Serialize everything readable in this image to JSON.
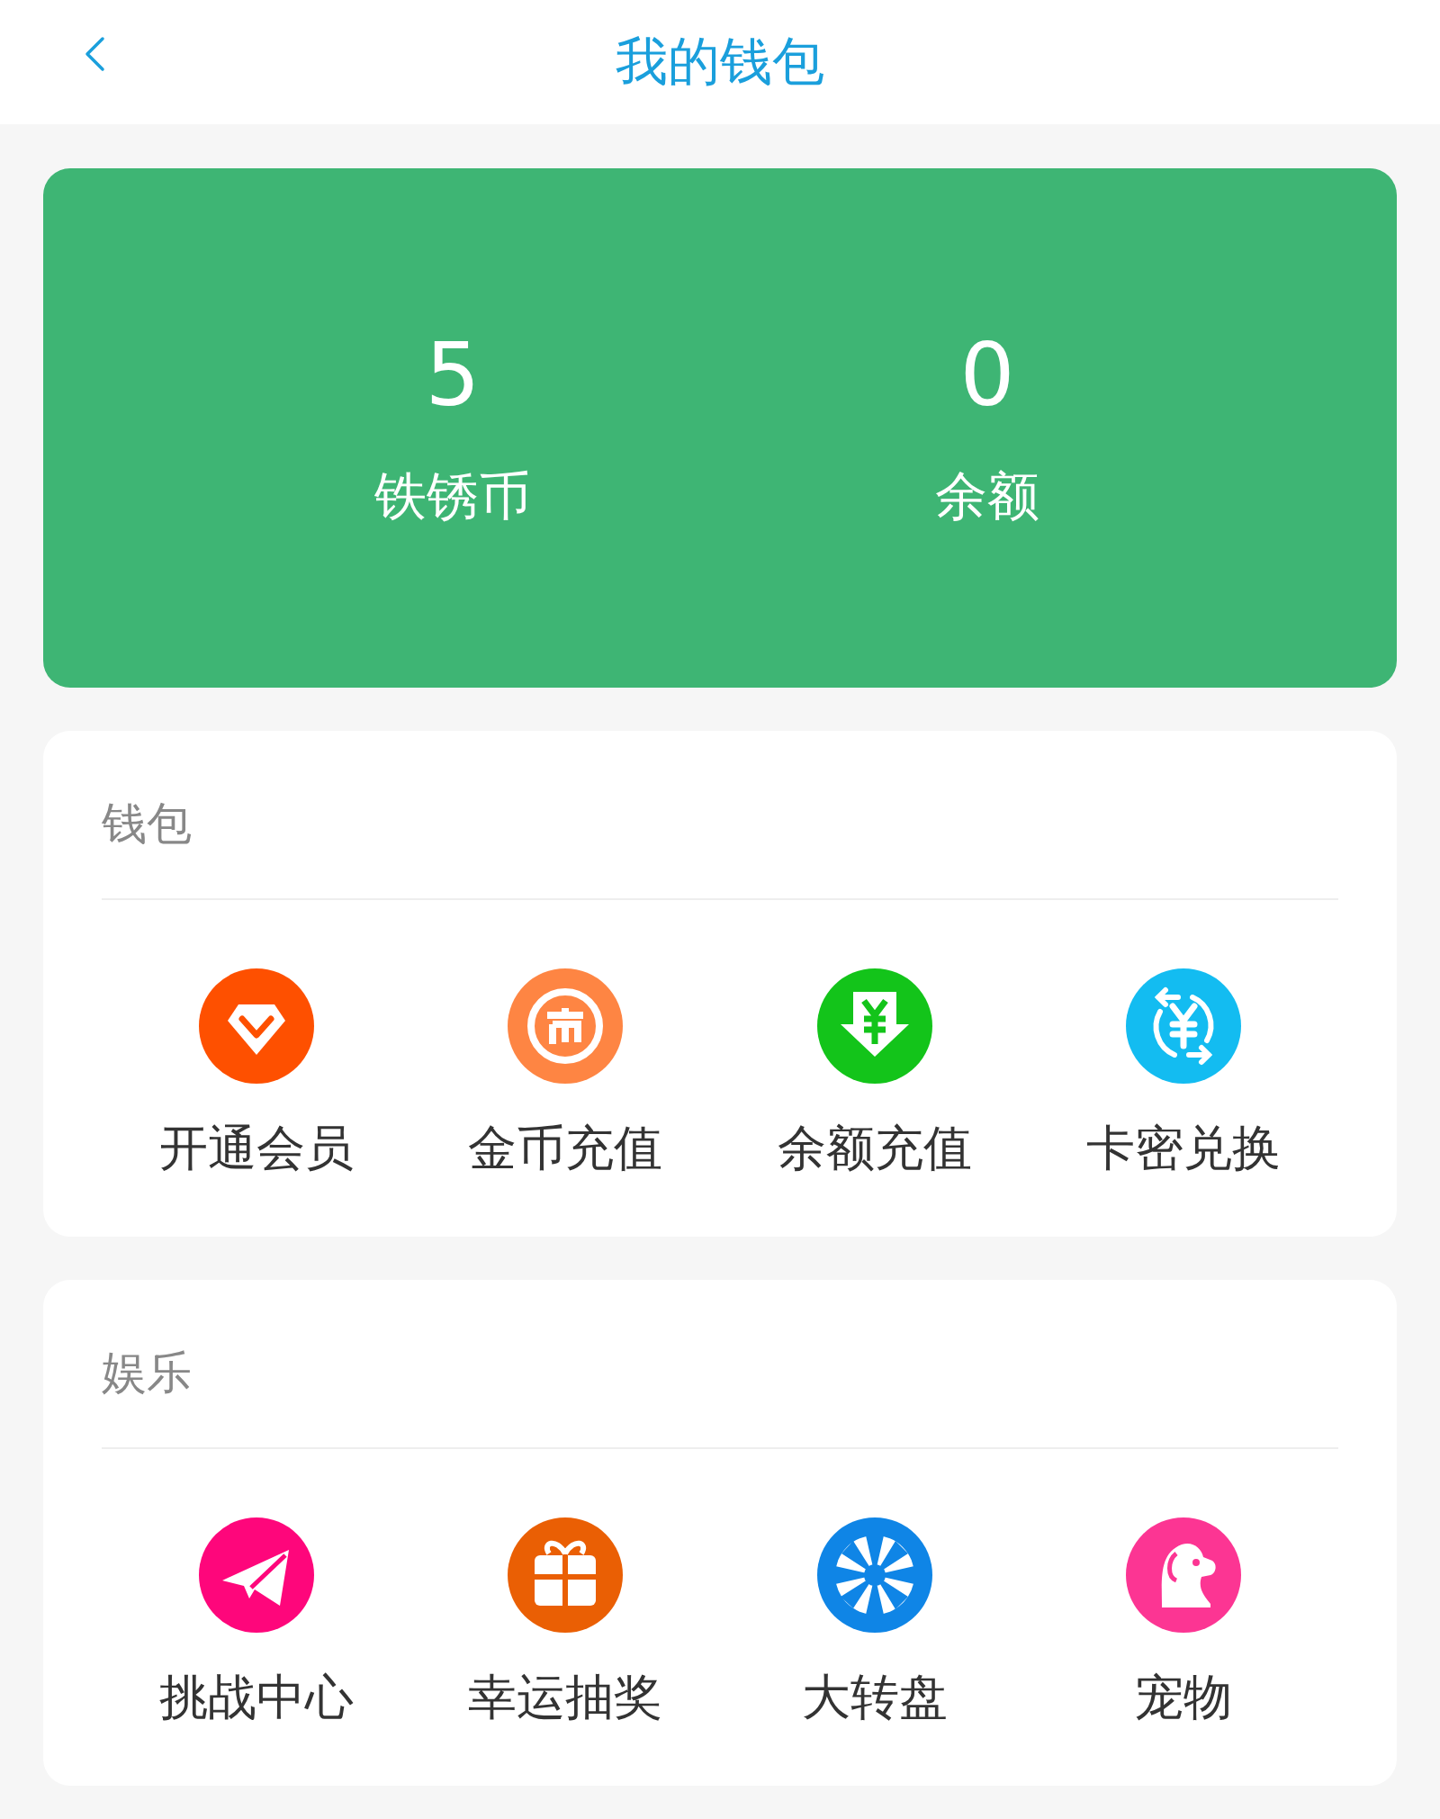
{
  "header": {
    "title": "我的钱包"
  },
  "summary": [
    {
      "value": "5",
      "label": "铁锈币"
    },
    {
      "value": "0",
      "label": "余额"
    }
  ],
  "sections": [
    {
      "title": "钱包",
      "items": [
        {
          "kind": "diamond",
          "label": "开通会员",
          "color": "#fe5000"
        },
        {
          "kind": "coin",
          "label": "金币充值",
          "color": "#fe8543"
        },
        {
          "kind": "yen-down",
          "label": "余额充值",
          "color": "#13c41a"
        },
        {
          "kind": "exchange",
          "label": "卡密兑换",
          "color": "#13bcf1"
        }
      ]
    },
    {
      "title": "娱乐",
      "items": [
        {
          "kind": "plane",
          "label": "挑战中心",
          "color": "#fe067b"
        },
        {
          "kind": "gift",
          "label": "幸运抽奖",
          "color": "#ea5f04"
        },
        {
          "kind": "wheel",
          "label": "大转盘",
          "color": "#0f85e6"
        },
        {
          "kind": "dog",
          "label": "宠物",
          "color": "#fc3593"
        }
      ]
    }
  ]
}
